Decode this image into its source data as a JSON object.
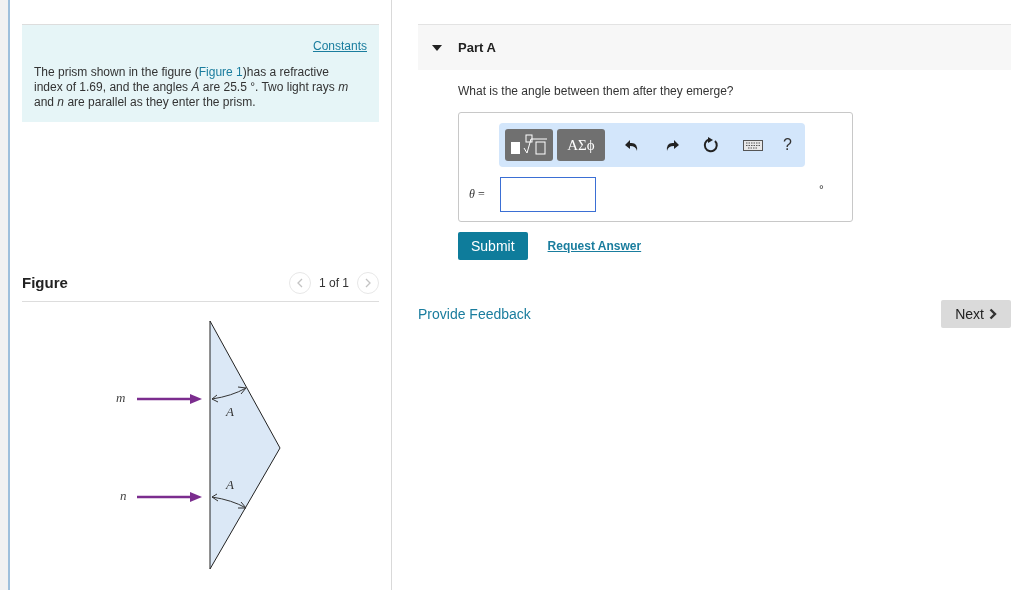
{
  "constants_link": "Constants",
  "problem": {
    "before": "The prism shown in the figure (",
    "link": "Figure 1",
    "after": ")has a refractive index of 1.69, and the angles *A* are 25.5 °. Two light rays *m* and *n* are parallel as they enter the prism."
  },
  "figure": {
    "title": "Figure",
    "pager": "1 of 1",
    "prev_disabled": true,
    "next_disabled": true,
    "labels": {
      "ray_top": "m",
      "ray_bottom": "n",
      "angle_top": "A",
      "angle_bottom": "A"
    }
  },
  "part": {
    "title": "Part A",
    "expanded": true,
    "question": "What is the angle between them after they emerge?"
  },
  "toolbar": {
    "greek_button": "ΑΣϕ",
    "help": "?"
  },
  "answer": {
    "label": "θ =",
    "unit": "°"
  },
  "submit": "Submit",
  "request_answer": "Request Answer",
  "feedback": "Provide Feedback",
  "next": "Next"
}
